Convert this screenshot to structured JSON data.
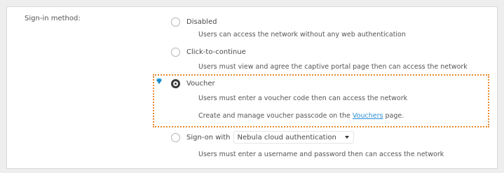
{
  "field_label": "Sign-in method:",
  "options": {
    "disabled": {
      "label": "Disabled",
      "desc": "Users can access the network without any web authentication"
    },
    "click_to_continue": {
      "label": "Click-to-continue",
      "desc": "Users must view and agree the captive portal page then can access the network"
    },
    "voucher": {
      "label": "Voucher",
      "desc": "Users must enter a voucher code then can access the network",
      "manage_prefix": "Create and manage voucher passcode on the ",
      "manage_link": "Vouchers",
      "manage_suffix": " page."
    },
    "sign_on": {
      "label": "Sign-on with",
      "select_value": "Nebula cloud authentication",
      "desc": "Users must enter a username and password then can access the network"
    }
  },
  "selected_option": "voucher",
  "highlight_color": "#e8892e",
  "gem_icon_color": "#2da3e0"
}
